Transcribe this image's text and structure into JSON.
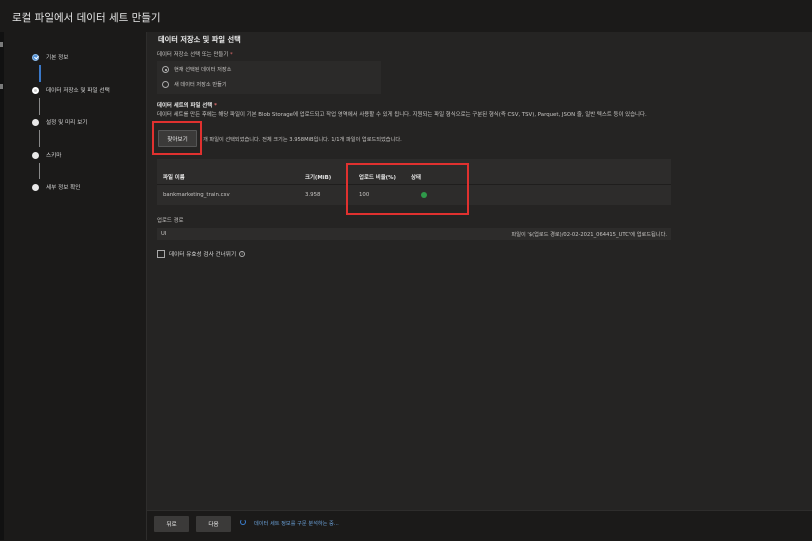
{
  "window": {
    "title": "로컬 파일에서 데이터 세트 만들기"
  },
  "steps": [
    {
      "label": "기본 정보",
      "state": "done"
    },
    {
      "label": "데이터 저장소 및 파일 선택",
      "state": "current"
    },
    {
      "label": "설정 및 미리 보기",
      "state": "pending"
    },
    {
      "label": "스키마",
      "state": "pending"
    },
    {
      "label": "세부 정보 확인",
      "state": "pending"
    }
  ],
  "main": {
    "heading": "데이터 저장소 및 파일 선택",
    "datastore": {
      "label": "데이터 저장소 선택 또는 만들기",
      "required_mark": "*",
      "options": [
        {
          "label": "현재 선택된 데이터 저장소",
          "selected": true
        },
        {
          "label": "새 데이터 저장소 만들기",
          "selected": false
        }
      ]
    },
    "file_select": {
      "label": "데이터 세트의 파일 선택",
      "required_mark": "*",
      "description": "데이터 세트를 만든 후에는 해당 파일이 기본 Blob Storage에 업로드되고 작업 영역에서 사용할 수 있게 됩니다. 지원되는 파일 형식으로는 구분된 형식(즉 CSV, TSV), Parquet, JSON 줄, 일반 텍스트 등이 있습니다.",
      "browse_label": "찾아보기",
      "status": "개 파일이 선택되었습니다. 전체 크기는 3.958MiB입니다. 1/1개 파일이 업로드되었습니다."
    },
    "table": {
      "headers": [
        "파일 이름",
        "크기(MiB)",
        "업로드 비율(%)",
        "상태"
      ],
      "rows": [
        {
          "name": "bankmarketing_train.csv",
          "size": "3.958",
          "percent": "100",
          "status_icon": "check-circle-icon"
        }
      ]
    },
    "upload_path": {
      "label": "업로드 경로",
      "value": "UI",
      "message": "파일이 '$(업로드 경로)/02-02-2021_064415_UTC'에 업로드됩니다."
    },
    "skip_validation": {
      "label": "데이터 유효성 검사 건너뛰기",
      "checked": false
    }
  },
  "footer": {
    "back_label": "뒤로",
    "next_label": "다음",
    "progress_text": "데이터 세트 정보를 구문 분석하는 중..."
  },
  "colors": {
    "accent": "#3b7fcf",
    "highlight_box": "#e0312f",
    "success": "#2f9a4a",
    "background": "#1b1a19",
    "panel": "#252423"
  }
}
